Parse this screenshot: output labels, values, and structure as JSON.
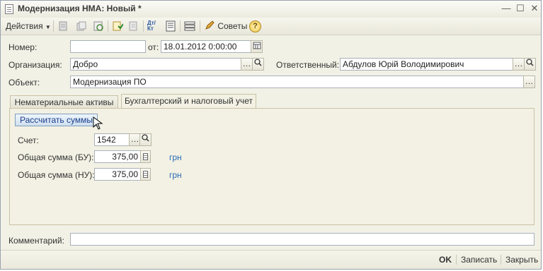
{
  "window": {
    "title": "Модернизация НМА: Новый *",
    "controls": {
      "minimize": "—",
      "maximize": "☐",
      "close": "✕"
    }
  },
  "toolbar": {
    "actions_label": "Действия",
    "advice_label": "Советы",
    "help_label": "?",
    "dtkt_label": "Дт/Кт"
  },
  "form": {
    "number": {
      "label": "Номер:",
      "value": ""
    },
    "date": {
      "label": "от:",
      "value": "18.01.2012  0:00:00"
    },
    "organization": {
      "label": "Организация:",
      "value": "Добро"
    },
    "responsible": {
      "label": "Ответственный:",
      "value": "Абдулов Юрій Володимирович"
    },
    "object": {
      "label": "Объект:",
      "value": "Модернизация ПО"
    }
  },
  "tabs": [
    {
      "label": "Нематериальные активы",
      "active": false
    },
    {
      "label": "Бухгалтерский и налоговый учет",
      "active": true
    }
  ],
  "accounting": {
    "calc_button": "Рассчитать суммы",
    "account": {
      "label": "Счет:",
      "value": "1542"
    },
    "sum_bu": {
      "label": "Общая сумма (БУ):",
      "value": "375,00",
      "unit": "грн"
    },
    "sum_nu": {
      "label": "Общая сумма (НУ):",
      "value": "375,00",
      "unit": "грн"
    }
  },
  "comment": {
    "label": "Комментарий:",
    "value": ""
  },
  "footer": {
    "ok": "OK",
    "save": "Записать",
    "close": "Закрыть"
  },
  "colors": {
    "accent": "#2a6bb5",
    "window_bg": "#f2f1e6"
  }
}
